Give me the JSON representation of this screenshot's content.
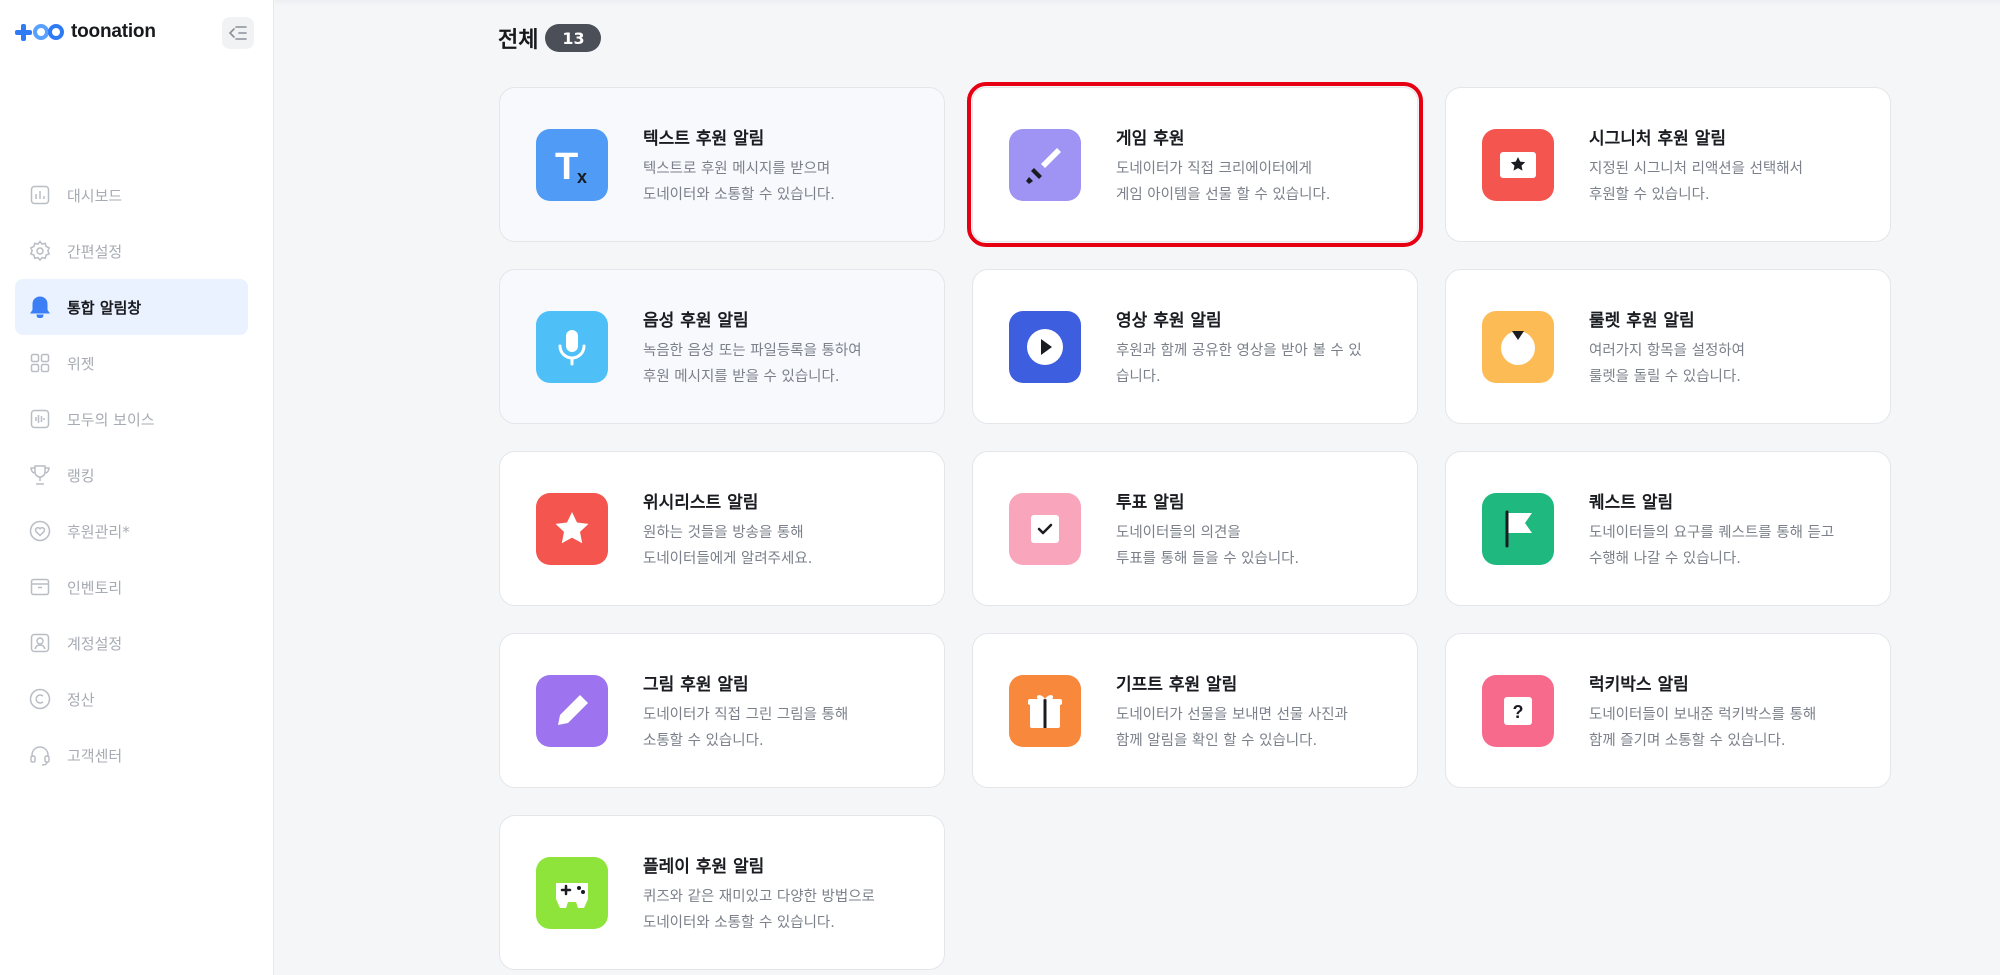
{
  "app": {
    "brand": "toonation"
  },
  "sidebar": {
    "items": [
      {
        "label": "대시보드",
        "icon": "dashboard-chart-icon",
        "active": false
      },
      {
        "label": "간편설정",
        "icon": "gear-icon",
        "active": false
      },
      {
        "label": "통합 알림창",
        "icon": "bell-icon",
        "active": true
      },
      {
        "label": "위젯",
        "icon": "widget-grid-icon",
        "active": false
      },
      {
        "label": "모두의 보이스",
        "icon": "voice-wave-icon",
        "active": false
      },
      {
        "label": "랭킹",
        "icon": "trophy-icon",
        "active": false
      },
      {
        "label": "후원관리*",
        "icon": "heart-circle-icon",
        "active": false
      },
      {
        "label": "인벤토리",
        "icon": "inventory-box-icon",
        "active": false
      },
      {
        "label": "계정설정",
        "icon": "user-account-icon",
        "active": false
      },
      {
        "label": "정산",
        "icon": "copyright-icon",
        "active": false
      },
      {
        "label": "고객센터",
        "icon": "headset-icon",
        "active": false
      }
    ]
  },
  "main": {
    "section_title": "전체",
    "count": "13",
    "cards": [
      {
        "title": "텍스트 후원 알림",
        "desc_line1": "텍스트로 후원 메시지를 받으며",
        "desc_line2": "도네이터와 소통할 수 있습니다.",
        "icon": "text-format-icon",
        "color": "#4f9bf5"
      },
      {
        "title": "게임 후원",
        "desc_line1": "도네이터가 직접 크리에이터에게",
        "desc_line2": "게임 아이템을 선물 할 수 있습니다.",
        "icon": "sword-icon",
        "color": "#9f94f3",
        "selected": true
      },
      {
        "title": "시그니처 후원 알림",
        "desc_line1": "지정된 시그니처 리액션을 선택해서",
        "desc_line2": "후원할 수 있습니다.",
        "icon": "signature-star-card-icon",
        "color": "#f4564f"
      },
      {
        "title": "음성 후원 알림",
        "desc_line1": "녹음한 음성 또는 파일등록을 통하여",
        "desc_line2": "후원 메시지를 받을 수 있습니다.",
        "icon": "microphone-icon",
        "color": "#4ec0f7"
      },
      {
        "title": "영상 후원 알림",
        "desc_line1": "후원과 함께 공유한 영상을 받아 볼 수 있",
        "desc_line2": "습니다.",
        "icon": "video-play-icon",
        "color": "#3e5ee0"
      },
      {
        "title": "룰렛 후원 알림",
        "desc_line1": "여러가지 항목을 설정하여",
        "desc_line2": "룰렛을 돌릴 수 있습니다.",
        "icon": "roulette-icon",
        "color": "#fdbb55"
      },
      {
        "title": "위시리스트 알림",
        "desc_line1": "원하는 것들을 방송을 통해",
        "desc_line2": "도네이터들에게 알려주세요.",
        "icon": "star-icon",
        "color": "#f4564f"
      },
      {
        "title": "투표 알림",
        "desc_line1": "도네이터들의 의견을",
        "desc_line2": "투표를 통해 들을 수 있습니다.",
        "icon": "vote-check-icon",
        "color": "#f9a6bd"
      },
      {
        "title": "퀘스트 알림",
        "desc_line1": "도네이터들의 요구를 퀘스트를 통해 듣고",
        "desc_line2": "수행해 나갈 수 있습니다.",
        "icon": "flag-icon",
        "color": "#1fb97f"
      },
      {
        "title": "그림 후원 알림",
        "desc_line1": "도네이터가 직접 그린 그림을 통해",
        "desc_line2": "소통할 수 있습니다.",
        "icon": "pencil-icon",
        "color": "#9d73f0"
      },
      {
        "title": "기프트 후원 알림",
        "desc_line1": "도네이터가 선물을 보내면 선물 사진과",
        "desc_line2": "함께 알림을 확인 할 수 있습니다.",
        "icon": "gift-icon",
        "color": "#f8883b"
      },
      {
        "title": "럭키박스 알림",
        "desc_line1": "도네이터들이 보내준 럭키박스를 통해",
        "desc_line2": "함께 즐기며 소통할 수 있습니다.",
        "icon": "lucky-box-question-icon",
        "color": "#f76a8b"
      },
      {
        "title": "플레이 후원 알림",
        "desc_line1": "퀴즈와 같은 재미있고 다양한 방법으로",
        "desc_line2": "도네이터와 소통할 수 있습니다.",
        "icon": "gamepad-icon",
        "color": "#8fe43b"
      }
    ]
  }
}
